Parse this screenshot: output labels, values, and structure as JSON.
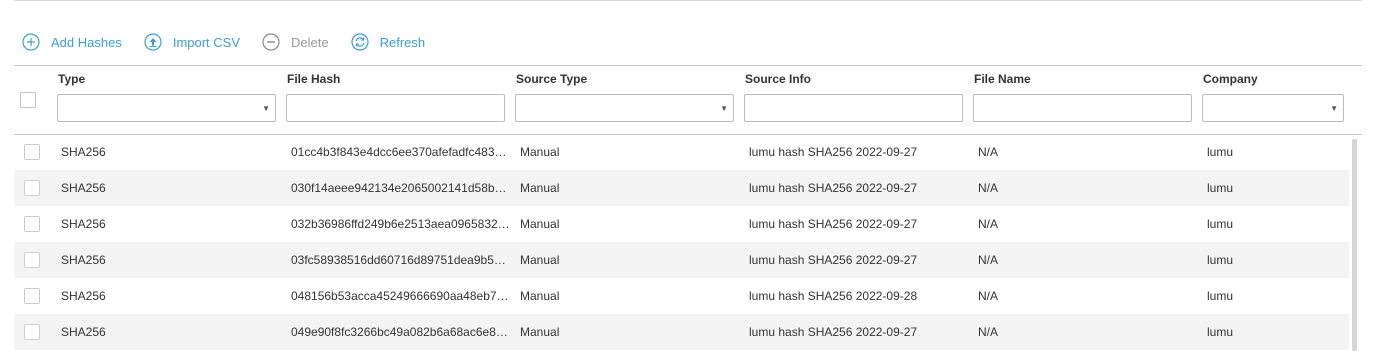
{
  "toolbar": {
    "add_label": "Add Hashes",
    "import_label": "Import CSV",
    "delete_label": "Delete",
    "refresh_label": "Refresh"
  },
  "columns": {
    "type": "Type",
    "file_hash": "File Hash",
    "source_type": "Source Type",
    "source_info": "Source Info",
    "file_name": "File Name",
    "company": "Company"
  },
  "rows": [
    {
      "type": "SHA256",
      "hash": "01cc4b3f843e4dcc6ee370afefadfc483…",
      "source_type": "Manual",
      "source_info": "lumu hash SHA256 2022-09-27",
      "file_name": "N/A",
      "company": "lumu"
    },
    {
      "type": "SHA256",
      "hash": "030f14aeee942134e2065002141d58b…",
      "source_type": "Manual",
      "source_info": "lumu hash SHA256 2022-09-27",
      "file_name": "N/A",
      "company": "lumu"
    },
    {
      "type": "SHA256",
      "hash": "032b36986ffd249b6e2513aea0965832…",
      "source_type": "Manual",
      "source_info": "lumu hash SHA256 2022-09-27",
      "file_name": "N/A",
      "company": "lumu"
    },
    {
      "type": "SHA256",
      "hash": "03fc58938516dd60716d89751dea9b5…",
      "source_type": "Manual",
      "source_info": "lumu hash SHA256 2022-09-27",
      "file_name": "N/A",
      "company": "lumu"
    },
    {
      "type": "SHA256",
      "hash": "048156b53acca45249666690aa48eb7…",
      "source_type": "Manual",
      "source_info": "lumu hash SHA256 2022-09-28",
      "file_name": "N/A",
      "company": "lumu"
    },
    {
      "type": "SHA256",
      "hash": "049e90f8fc3266bc49a082b6a68ac6e8…",
      "source_type": "Manual",
      "source_info": "lumu hash SHA256 2022-09-27",
      "file_name": "N/A",
      "company": "lumu"
    }
  ],
  "colors": {
    "accent": "#3a9fd6",
    "disabled": "#999999",
    "row_alt": "#f4f4f4"
  },
  "icons": {
    "add": "plus-circle-icon",
    "import": "upload-circle-icon",
    "delete": "minus-circle-icon",
    "refresh": "refresh-icon"
  }
}
